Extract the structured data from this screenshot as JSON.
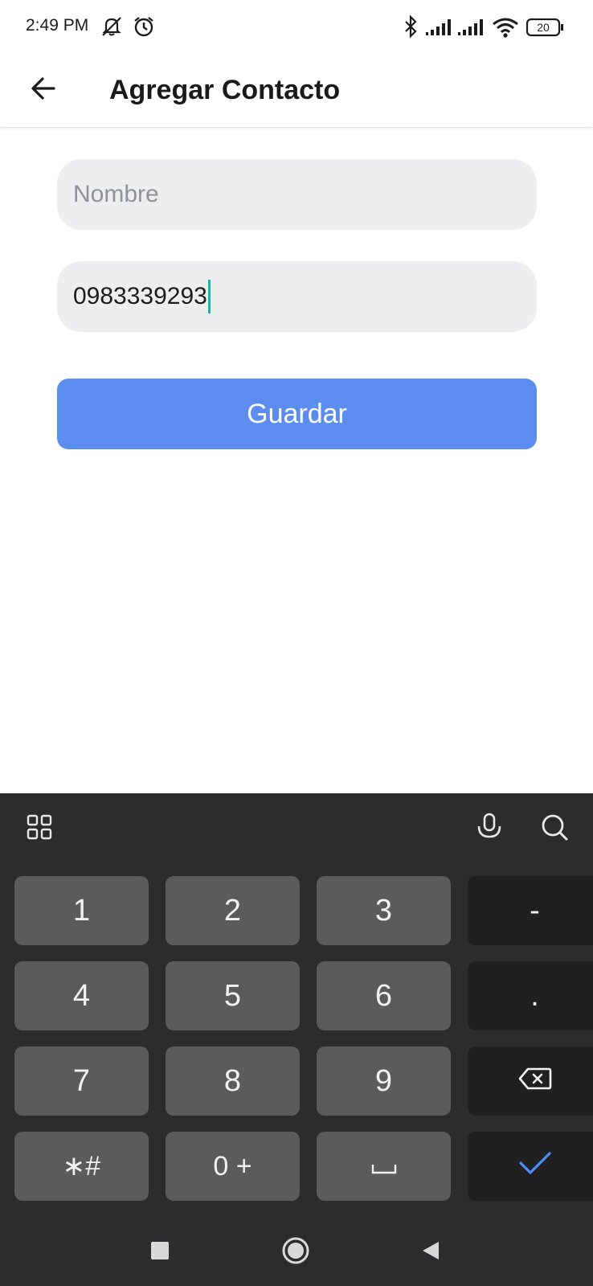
{
  "status_bar": {
    "time": "2:49 PM",
    "icons": [
      "mute-icon",
      "alarm-icon",
      "bluetooth-icon",
      "signal-icon",
      "signal-icon",
      "wifi-icon",
      "battery-icon"
    ],
    "battery": "20"
  },
  "app_bar": {
    "back_icon": "arrow-left-icon",
    "title": "Agregar Contacto"
  },
  "form": {
    "name_placeholder": "Nombre",
    "name_value": "",
    "phone_value": "0983339293",
    "save_label": "Guardar"
  },
  "keyboard": {
    "toolbar_icons": [
      "grid-icon",
      "microphone-icon",
      "search-icon"
    ],
    "keys": {
      "k1": "1",
      "k2": "2",
      "k3": "3",
      "dash": "-",
      "k4": "4",
      "k5": "5",
      "k6": "6",
      "dot": ".",
      "k7": "7",
      "k8": "8",
      "k9": "9",
      "star_hash": "∗#",
      "zero_plus": "0 +"
    },
    "icon_keys": [
      "backspace-icon",
      "space-icon",
      "check-icon"
    ]
  },
  "navbar": {
    "icons": [
      "recents-icon",
      "home-icon",
      "back-icon"
    ]
  },
  "colors": {
    "accent": "#5b8def",
    "caret": "#17b8a6",
    "keyboard_bg": "#2c2c2e",
    "key_bg": "#5b5b5d",
    "func_key_bg": "#202022",
    "check": "#4a8ff5"
  }
}
